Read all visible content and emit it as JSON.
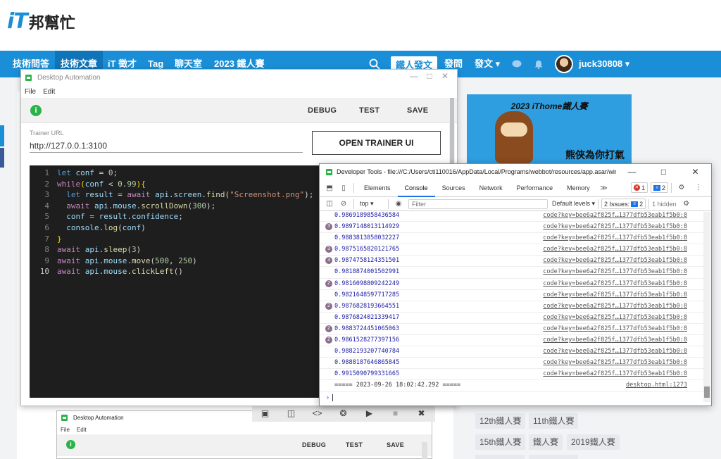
{
  "site": {
    "logo_it": "iT",
    "logo_zh": "邦幫忙",
    "nav": [
      "技術問答",
      "技術文章",
      "iT 徵才",
      "Tag",
      "聊天室",
      "2023 鐵人賽"
    ],
    "post_button": "鐵人發文",
    "ask": "發問",
    "write": "發文 ▾",
    "username": "juck30808 ▾",
    "banner_title": "2023 iThome鐵人賽",
    "banner_sub": "熊俠為你打氣",
    "tags": [
      "12th鐵人賽",
      "11th鐵人賽",
      "15th鐵人賽",
      "鐵人賽",
      "2019鐵人賽"
    ]
  },
  "app": {
    "title": "Desktop Automation",
    "menu": [
      "File",
      "Edit"
    ],
    "status": "i",
    "debug": "DEBUG",
    "test": "TEST",
    "save": "SAVE",
    "trainer_label": "Trainer URL",
    "trainer_url": "http://127.0.0.1:3100",
    "open_trainer": "OPEN TRAINER UI",
    "line_numbers": [
      "1",
      "2",
      "3",
      "4",
      "5",
      "6",
      "7",
      "8",
      "9",
      "10"
    ]
  },
  "devtools": {
    "title": "Developer Tools - file:///C:/Users/cti110016/AppData/Local/Programs/webbot/resources/app.asar/win...",
    "tabs": [
      "Elements",
      "Console",
      "Sources",
      "Network",
      "Performance",
      "Memory"
    ],
    "more_tabs": "≫",
    "errors": "1",
    "messages": "2",
    "context": "top",
    "filter_placeholder": "Filter",
    "levels": "Default levels ▾",
    "issues": "2 Issues:",
    "issues_count": "2",
    "hidden": "1 hidden",
    "logs": [
      {
        "count": "",
        "value": "0.9869189858436584",
        "source": "code?key=bee6a2f825f…1377dfb53eab1f5b0:8"
      },
      {
        "count": "3",
        "value": "0.9897148013114929",
        "source": "code?key=bee6a2f825f…1377dfb53eab1f5b0:8"
      },
      {
        "count": "",
        "value": "0.9883813858032227",
        "source": "code?key=bee6a2f825f…1377dfb53eab1f5b0:8"
      },
      {
        "count": "3",
        "value": "0.9875165820121765",
        "source": "code?key=bee6a2f825f…1377dfb53eab1f5b0:8"
      },
      {
        "count": "3",
        "value": "0.9874758124351501",
        "source": "code?key=bee6a2f825f…1377dfb53eab1f5b0:8"
      },
      {
        "count": "",
        "value": "0.9818874001502991",
        "source": "code?key=bee6a2f825f…1377dfb53eab1f5b0:8"
      },
      {
        "count": "2",
        "value": "0.9816098809242249",
        "source": "code?key=bee6a2f825f…1377dfb53eab1f5b0:8"
      },
      {
        "count": "",
        "value": "0.9821648597717285",
        "source": "code?key=bee6a2f825f…1377dfb53eab1f5b0:8"
      },
      {
        "count": "2",
        "value": "0.9876828193664551",
        "source": "code?key=bee6a2f825f…1377dfb53eab1f5b0:8"
      },
      {
        "count": "",
        "value": "0.9876824021339417",
        "source": "code?key=bee6a2f825f…1377dfb53eab1f5b0:8"
      },
      {
        "count": "2",
        "value": "0.9883724451065063",
        "source": "code?key=bee6a2f825f…1377dfb53eab1f5b0:8"
      },
      {
        "count": "2",
        "value": "0.9861528277397156",
        "source": "code?key=bee6a2f825f…1377dfb53eab1f5b0:8"
      },
      {
        "count": "",
        "value": "0.9882193207740784",
        "source": "code?key=bee6a2f825f…1377dfb53eab1f5b0:8"
      },
      {
        "count": "",
        "value": "0.9888187646865845",
        "source": "code?key=bee6a2f825f…1377dfb53eab1f5b0:8"
      },
      {
        "count": "",
        "value": "0.9915090799331665",
        "source": "code?key=bee6a2f825f…1377dfb53eab1f5b0:8"
      }
    ],
    "final_log": "===== 2023-09-26 18:02:42.292 =====",
    "final_source": "desktop.html:1273",
    "prompt": "›"
  }
}
